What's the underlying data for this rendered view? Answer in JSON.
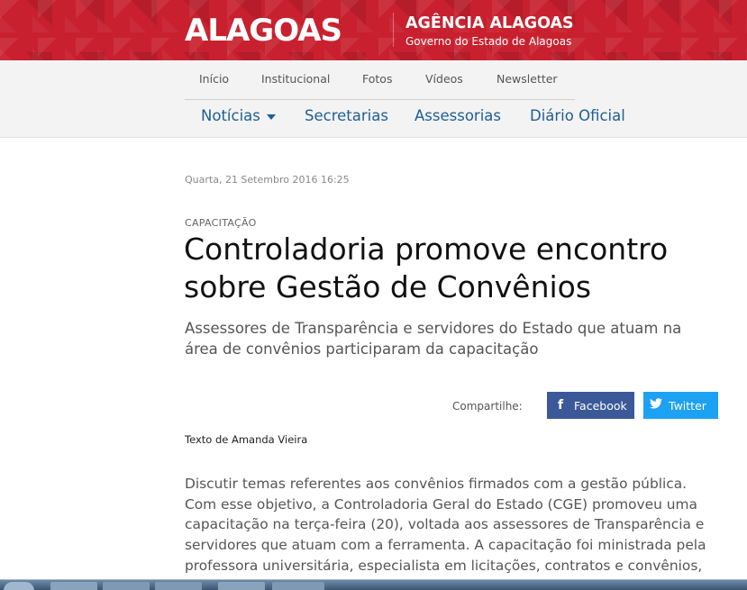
{
  "header": {
    "logo_text": "ALAGOAS",
    "agency_title": "AGÊNCIA ALAGOAS",
    "agency_subtitle": "Governo do Estado de Alagoas",
    "banner_color": "#c8202e"
  },
  "top_nav": [
    "Início",
    "Institucional",
    "Fotos",
    "Vídeos",
    "Newsletter"
  ],
  "main_nav": [
    "Notícias",
    "Secretarias",
    "Assessorias",
    "Diário Oficial"
  ],
  "article": {
    "date": "Quarta, 21 Setembro 2016 16:25",
    "category": "CAPACITAÇÃO",
    "title_line1": "Controladoria promove encontro",
    "title_line2": "sobre Gestão de Convênios",
    "subtitle": "Assessores de Transparência e servidores do Estado que atuam na área de convênios participaram da capacitação",
    "share_label": "Compartilhe:",
    "facebook_label": "Facebook",
    "twitter_label": "Twitter",
    "author": "Texto de Amanda Vieira",
    "body": "Discutir temas referentes aos convênios firmados com a gestão pública. Com esse objetivo, a Controladoria Geral do Estado (CGE) promoveu uma capacitação na terça-feira (20), voltada aos assessores de Transparência e servidores que atuam com a ferramenta. A capacitação foi ministrada pela professora universitária, especialista em licitações, contratos e convênios, Ana"
  },
  "colors": {
    "link_blue": "#1d5e96",
    "facebook": "#3b5998",
    "twitter": "#1da1f2"
  },
  "icons": {
    "facebook": "facebook-icon",
    "twitter": "twitter-icon",
    "dropdown": "chevron-down-icon"
  }
}
